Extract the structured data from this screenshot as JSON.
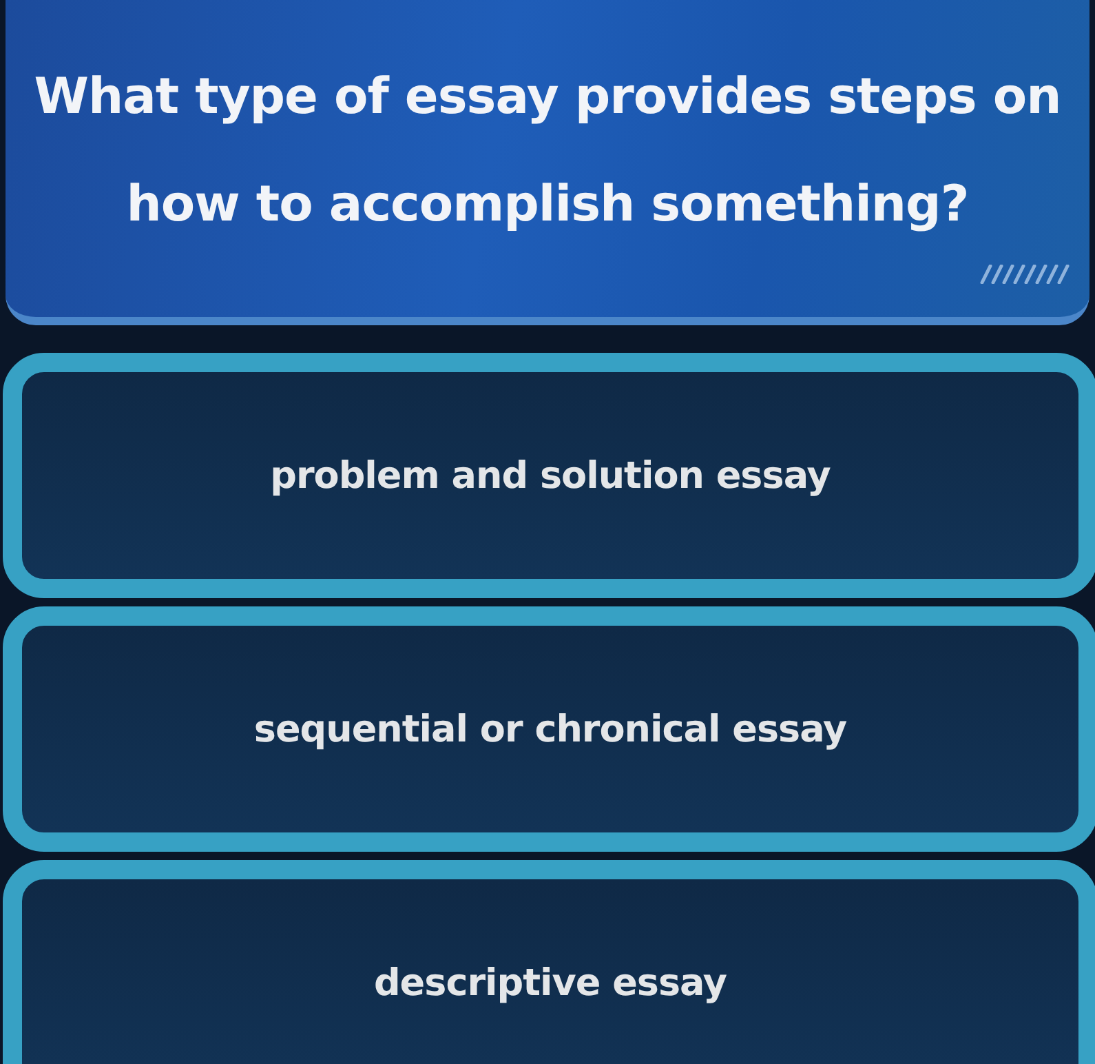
{
  "question": {
    "text": "What type of essay provides steps on how to accomplish something?"
  },
  "options": [
    {
      "label": "problem and solution essay",
      "selected": false
    },
    {
      "label": "sequential or chronical essay",
      "selected": false
    },
    {
      "label": "descriptive essay",
      "selected": false
    }
  ]
}
